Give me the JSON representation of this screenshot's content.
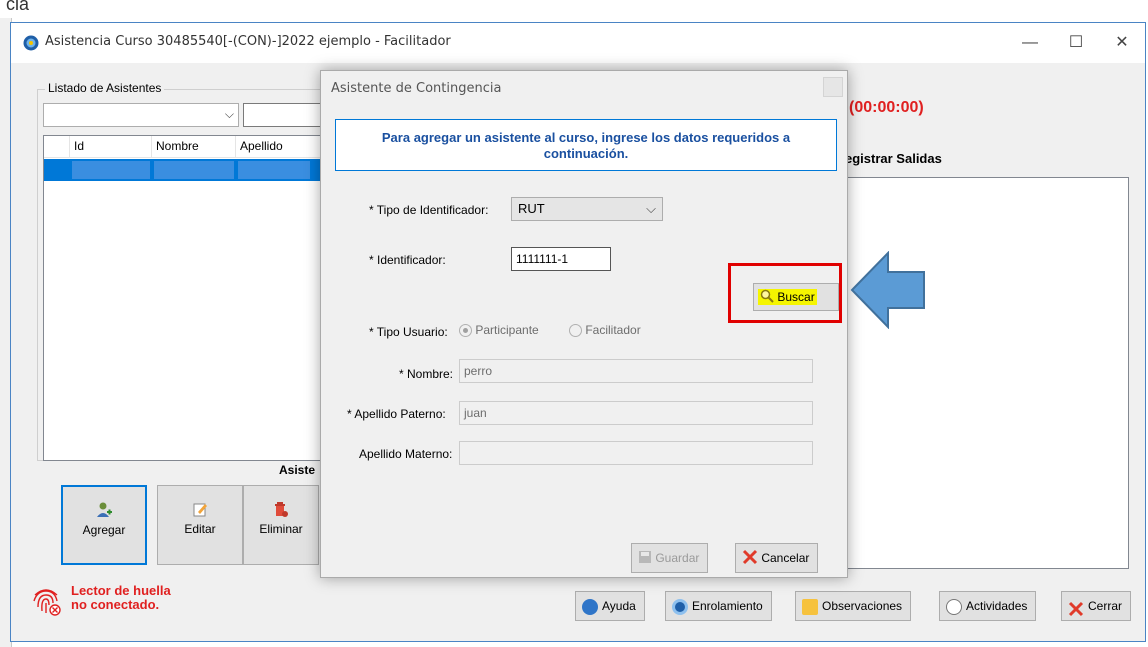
{
  "background": {
    "title_fragment": "cia"
  },
  "window": {
    "title": "Asistencia Curso 30485540[-(CON)-]2022 ejemplo - Facilitador",
    "controls": {
      "minimize": "—",
      "maximize": "☐",
      "close": "✕"
    }
  },
  "list_panel": {
    "group_label": "Listado de Asistentes",
    "filter_value": "",
    "search_value": "",
    "columns": [
      "Id",
      "Nombre",
      "Apellido"
    ],
    "footer_label": "Asiste",
    "buttons": {
      "add": "Agregar",
      "edit": "Editar",
      "delete": "Eliminar"
    }
  },
  "right_panel": {
    "timer": "(00:00:00)",
    "title": "egistrar Salidas"
  },
  "status": {
    "line1": "Lector de huella",
    "line2": "no conectado."
  },
  "bottom_buttons": {
    "help": "Ayuda",
    "enroll": "Enrolamiento",
    "observations": "Observaciones",
    "activities": "Actividades",
    "close": "Cerrar"
  },
  "dialog": {
    "title": "Asistente de Contingencia",
    "banner": "Para agregar un asistente al curso, ingrese los datos requeridos a continuación.",
    "id_type_label": "* Tipo de Identificador:",
    "id_type_value": "RUT",
    "identifier_label": "* Identificador:",
    "identifier_value": "1111111-1",
    "search_button": "Buscar",
    "user_type_label": "* Tipo Usuario:",
    "user_type_options": [
      "Participante",
      "Facilitador"
    ],
    "user_type_selected": "Participante",
    "name_label": "* Nombre:",
    "name_value": "perro",
    "paternal_label": "* Apellido Paterno:",
    "paternal_value": "juan",
    "maternal_label": "Apellido Materno:",
    "maternal_value": "",
    "save_button": "Guardar",
    "cancel_button": "Cancelar"
  },
  "colors": {
    "accent": "#0078d7",
    "highlight_box": "#e00000",
    "status_red": "#e02020",
    "arrow_fill": "#5b9bd5",
    "search_highlight": "#f5f500"
  }
}
